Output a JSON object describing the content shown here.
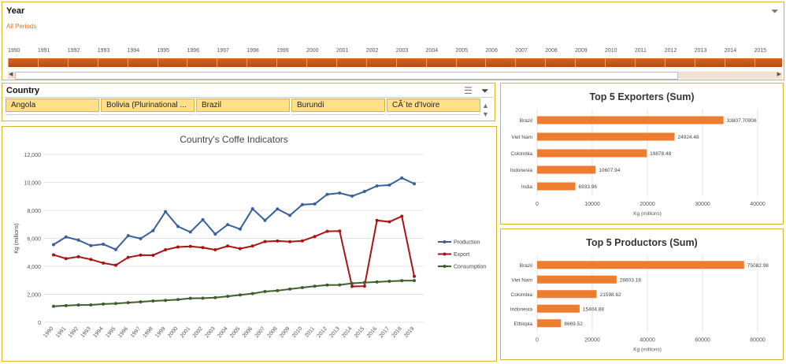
{
  "timeline": {
    "title": "Year",
    "filter": "All Periods",
    "years": [
      "1990",
      "1991",
      "1992",
      "1993",
      "1994",
      "1995",
      "1996",
      "1997",
      "1998",
      "1999",
      "2000",
      "2001",
      "2002",
      "2003",
      "2004",
      "2005",
      "2006",
      "2007",
      "2008",
      "2009",
      "2010",
      "2011",
      "2012",
      "2013",
      "2014",
      "2015"
    ]
  },
  "slicer": {
    "title": "Country",
    "items": [
      "Angola",
      "Bolivia (Plurinational ...",
      "Brazil",
      "Burundi",
      "CÃ´te d'Ivoire"
    ]
  },
  "icons": {
    "clear_filter_timeline": "clear-filter-icon",
    "multi_select": "multi-select-icon",
    "clear_filter_slicer": "clear-filter-icon",
    "scroll_up": "chevron-up-icon",
    "scroll_down": "chevron-down-icon"
  },
  "colors": {
    "accent_border": "#d9b72a",
    "timeline_bar": "#c2551d",
    "slicer_item": "#ffe08a",
    "production": "#3a5f9e",
    "export": "#a81414",
    "consumption": "#3f5f2a",
    "bar": "#ed7d31"
  },
  "chart_data": [
    {
      "type": "line",
      "title": "Country's Coffe  Indicators",
      "ylabel": "Kg (millions)",
      "xlabel": "",
      "ylim": [
        0,
        12000
      ],
      "yticks": [
        "0",
        "2,000",
        "4,000",
        "6,000",
        "8,000",
        "10,000",
        "12,000"
      ],
      "grid": true,
      "legend": "right",
      "x": [
        "1990",
        "1991",
        "1992",
        "1993",
        "1994",
        "1995",
        "1996",
        "1997",
        "1998",
        "1999",
        "2000",
        "2001",
        "2002",
        "2003",
        "2004",
        "2005",
        "2006",
        "2007",
        "2008",
        "2009",
        "2010",
        "2011",
        "2012",
        "2013",
        "2014",
        "2015",
        "2016",
        "2017",
        "2018",
        "2019"
      ],
      "series": [
        {
          "name": "Production",
          "values": [
            5550,
            6100,
            5870,
            5480,
            5580,
            5200,
            6190,
            5980,
            6550,
            7910,
            6850,
            6450,
            7330,
            6300,
            6980,
            6660,
            8110,
            7280,
            8100,
            7640,
            8410,
            8460,
            9140,
            9240,
            9020,
            9350,
            9750,
            9810,
            10320,
            9900
          ]
        },
        {
          "name": "Export",
          "values": [
            4820,
            4550,
            4680,
            4490,
            4230,
            4080,
            4640,
            4800,
            4790,
            5180,
            5380,
            5420,
            5340,
            5180,
            5450,
            5260,
            5450,
            5770,
            5810,
            5760,
            5820,
            6130,
            6500,
            6520,
            2560,
            2580,
            7280,
            7180,
            7580,
            3280
          ]
        },
        {
          "name": "Consumption",
          "values": [
            1140,
            1190,
            1230,
            1240,
            1300,
            1340,
            1400,
            1460,
            1520,
            1560,
            1620,
            1710,
            1720,
            1760,
            1850,
            1950,
            2050,
            2200,
            2260,
            2370,
            2480,
            2580,
            2660,
            2670,
            2780,
            2840,
            2880,
            2930,
            2970,
            2980
          ]
        }
      ]
    },
    {
      "type": "bar",
      "title": "Top 5 Exporters (Sum)",
      "xlabel": "Kg (millions)",
      "xlim": [
        0,
        40000
      ],
      "xticks": [
        "0",
        "10000",
        "20000",
        "30000",
        "40000"
      ],
      "categories": [
        "Brazil",
        "Viet Nam",
        "Colombia",
        "Indonesia",
        "India"
      ],
      "values": [
        33807.70906,
        24924.48,
        19878.48,
        10607.94,
        6933.96
      ],
      "labels": [
        "33807.70906",
        "24924.48",
        "19878.48",
        "10607.94",
        "6933.96"
      ]
    },
    {
      "type": "bar",
      "title": "Top 5 Productors (Sum)",
      "xlabel": "Kg (millions)",
      "xlim": [
        0,
        80000
      ],
      "xticks": [
        "0",
        "20000",
        "40000",
        "60000",
        "80000"
      ],
      "categories": [
        "Brazil",
        "Viet Nam",
        "Colombia",
        "Indonesia",
        "Ethiopia"
      ],
      "values": [
        75082.98,
        28803.18,
        21598.62,
        15404.88,
        8669.52
      ],
      "labels": [
        "75082.98",
        "28803.18",
        "21598.62",
        "15404.88",
        "8669.52"
      ]
    }
  ]
}
